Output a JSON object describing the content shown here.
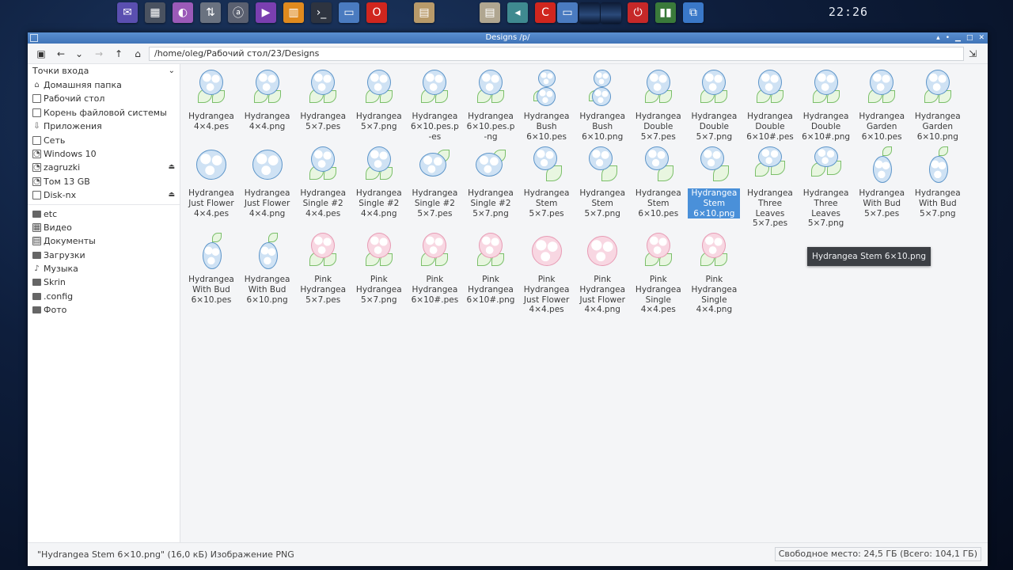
{
  "panel": {
    "clock": "22:26",
    "launchers": [
      {
        "name": "mail-launcher-icon",
        "glyph": "✉",
        "color": "#5a4fb0"
      },
      {
        "name": "calculator-launcher-icon",
        "glyph": "▦",
        "color": "#4a5260"
      },
      {
        "name": "paint-launcher-icon",
        "glyph": "◐",
        "color": "#9b5ab8"
      },
      {
        "name": "transfer-launcher-icon",
        "glyph": "⇅",
        "color": "#6a7280"
      },
      {
        "name": "app-launcher-icon",
        "glyph": "ⓐ",
        "color": "#5a6070"
      },
      {
        "name": "media-player-launcher-icon",
        "glyph": "▶",
        "color": "#7a3fb0"
      },
      {
        "name": "audio-launcher-icon",
        "glyph": "▥",
        "color": "#e08a1e"
      },
      {
        "name": "terminal-launcher-icon",
        "glyph": "›_",
        "color": "#2e3440"
      },
      {
        "name": "file-manager-launcher-icon",
        "glyph": "▭",
        "color": "#4a7bc0"
      },
      {
        "name": "opera-launcher-icon",
        "glyph": "O",
        "color": "#d0261e"
      },
      {
        "name": "notes-launcher-icon",
        "glyph": "▤",
        "color": "#b89a6a"
      },
      {
        "name": "document-viewer-icon",
        "glyph": "▤",
        "color": "#b0a690"
      },
      {
        "name": "volume-icon",
        "glyph": "◂",
        "color": "#3f8a90"
      },
      {
        "name": "opera-window-icon",
        "glyph": "C",
        "color": "#d0261e"
      },
      {
        "name": "file-manager-window-icon",
        "glyph": "▭",
        "color": "#4a7bc0"
      },
      {
        "name": "workspace-1-icon",
        "glyph": "",
        "color": "#1a2a4a"
      },
      {
        "name": "workspace-2-icon",
        "glyph": "",
        "color": "#1a2a4a"
      },
      {
        "name": "power-icon",
        "glyph": "⏻",
        "color": "#c62828"
      },
      {
        "name": "system-monitor-icon",
        "glyph": "▮▮",
        "color": "#3a7a3a"
      },
      {
        "name": "network-icon",
        "glyph": "⧉",
        "color": "#3a78c8"
      }
    ]
  },
  "window": {
    "title": "Designs   /p/",
    "path": "/home/oleg/Рабочий стол/23/Designs"
  },
  "sidebar": {
    "header": "Точки входа",
    "places": [
      {
        "name": "sidebar-item-home",
        "icon": "home-icon",
        "glyph": "⌂",
        "label": "Домашняя папка",
        "eject": false
      },
      {
        "name": "sidebar-item-desktop",
        "icon": "desktop-icon",
        "glyph": "",
        "label": "Рабочий стол",
        "eject": false
      },
      {
        "name": "sidebar-item-root",
        "icon": "filesystem-icon",
        "glyph": "",
        "label": "Корень файловой системы",
        "eject": false
      },
      {
        "name": "sidebar-item-applications",
        "icon": "applications-icon",
        "glyph": "⇩",
        "label": "Приложения",
        "eject": false
      },
      {
        "name": "sidebar-item-network",
        "icon": "network-icon",
        "glyph": "",
        "label": "Сеть",
        "eject": false
      },
      {
        "name": "sidebar-item-windows10",
        "icon": "drive-icon",
        "glyph": "◔",
        "label": "Windows 10",
        "eject": false
      },
      {
        "name": "sidebar-item-zagruzki",
        "icon": "drive-icon",
        "glyph": "◔",
        "label": "zagruzki",
        "eject": true
      },
      {
        "name": "sidebar-item-volume-13gb",
        "icon": "drive-icon",
        "glyph": "◔",
        "label": "Том 13 GB",
        "eject": false
      },
      {
        "name": "sidebar-item-disk-nx",
        "icon": "removable-drive-icon",
        "glyph": "",
        "label": "Disk-nx",
        "eject": true
      }
    ],
    "bookmarks": [
      {
        "name": "sidebar-item-etc",
        "icon": "folder-icon",
        "glyph": "",
        "label": "etc"
      },
      {
        "name": "sidebar-item-video",
        "icon": "video-icon",
        "glyph": "▦",
        "label": "Видео"
      },
      {
        "name": "sidebar-item-documents",
        "icon": "documents-icon",
        "glyph": "▤",
        "label": "Документы"
      },
      {
        "name": "sidebar-item-downloads",
        "icon": "downloads-icon",
        "glyph": "",
        "label": "Загрузки"
      },
      {
        "name": "sidebar-item-music",
        "icon": "music-icon",
        "glyph": "♪",
        "label": "Музыка"
      },
      {
        "name": "sidebar-item-skrin",
        "icon": "folder-icon",
        "glyph": "",
        "label": "Skrin"
      },
      {
        "name": "sidebar-item-config",
        "icon": "folder-icon",
        "glyph": "",
        "label": ".config"
      },
      {
        "name": "sidebar-item-photo",
        "icon": "folder-icon",
        "glyph": "",
        "label": "Фото"
      }
    ]
  },
  "files": [
    {
      "label": "Hydrangea 4×4.pes",
      "color": "blue",
      "style": "single"
    },
    {
      "label": "Hydrangea 4×4.png",
      "color": "blue",
      "style": "single"
    },
    {
      "label": "Hydrangea 5×7.pes",
      "color": "blue",
      "style": "single"
    },
    {
      "label": "Hydrangea 5×7.png",
      "color": "blue",
      "style": "single"
    },
    {
      "label": "Hydrangea 6×10.pes.p-es",
      "color": "blue",
      "style": "single"
    },
    {
      "label": "Hydrangea 6×10.pes.p-ng",
      "color": "blue",
      "style": "single"
    },
    {
      "label": "Hydrangea Bush 6×10.pes",
      "color": "blue",
      "style": "bush"
    },
    {
      "label": "Hydrangea Bush 6×10.png",
      "color": "blue",
      "style": "bush"
    },
    {
      "label": "Hydrangea Double 5×7.pes",
      "color": "blue",
      "style": "double"
    },
    {
      "label": "Hydrangea Double 5×7.png",
      "color": "blue",
      "style": "double"
    },
    {
      "label": "Hydrangea Double 6×10#.pes",
      "color": "blue",
      "style": "double"
    },
    {
      "label": "Hydrangea Double 6×10#.png",
      "color": "blue",
      "style": "double"
    },
    {
      "label": "Hydrangea Garden 6×10.pes",
      "color": "blue",
      "style": "garden"
    },
    {
      "label": "Hydrangea Garden 6×10.png",
      "color": "blue",
      "style": "garden"
    },
    {
      "label": "Hydrangea Just Flower 4×4.pes",
      "color": "blue",
      "style": "flower"
    },
    {
      "label": "Hydrangea Just Flower 4×4.png",
      "color": "blue",
      "style": "flower"
    },
    {
      "label": "Hydrangea Single #2 4×4.pes",
      "color": "blue",
      "style": "single"
    },
    {
      "label": "Hydrangea Single #2 4×4.png",
      "color": "blue",
      "style": "single"
    },
    {
      "label": "Hydrangea Single #2 5×7.pes",
      "color": "blue",
      "style": "wide"
    },
    {
      "label": "Hydrangea Single #2 5×7.png",
      "color": "blue",
      "style": "wide"
    },
    {
      "label": "Hydrangea Stem 5×7.pes",
      "color": "blue",
      "style": "stem"
    },
    {
      "label": "Hydrangea Stem 5×7.png",
      "color": "blue",
      "style": "stem"
    },
    {
      "label": "Hydrangea Stem 6×10.pes",
      "color": "blue",
      "style": "stem"
    },
    {
      "label": "Hydrangea Stem 6×10.png",
      "color": "blue",
      "style": "stem",
      "selected": true
    },
    {
      "label": "Hydrangea Three Leaves 5×7.pes",
      "color": "blue",
      "style": "leaves"
    },
    {
      "label": "Hydrangea Three Leaves 5×7.png",
      "color": "blue",
      "style": "leaves"
    },
    {
      "label": "Hydrangea With Bud 5×7.pes",
      "color": "blue",
      "style": "bud"
    },
    {
      "label": "Hydrangea With Bud 5×7.png",
      "color": "blue",
      "style": "bud"
    },
    {
      "label": "Hydrangea With Bud 6×10.pes",
      "color": "blue",
      "style": "bud"
    },
    {
      "label": "Hydrangea With Bud 6×10.png",
      "color": "blue",
      "style": "bud"
    },
    {
      "label": "Pink Hydrangea 5×7.pes",
      "color": "pink",
      "style": "single"
    },
    {
      "label": "Pink Hydrangea 5×7.png",
      "color": "pink",
      "style": "single"
    },
    {
      "label": "Pink Hydrangea 6×10#.pes",
      "color": "pink",
      "style": "single"
    },
    {
      "label": "Pink Hydrangea 6×10#.png",
      "color": "pink",
      "style": "single"
    },
    {
      "label": "Pink Hydrangea Just Flower 4×4.pes",
      "color": "pink",
      "style": "flower"
    },
    {
      "label": "Pink Hydrangea Just Flower 4×4.png",
      "color": "pink",
      "style": "flower"
    },
    {
      "label": "Pink Hydrangea Single 4×4.pes",
      "color": "pink",
      "style": "single"
    },
    {
      "label": "Pink Hydrangea Single 4×4.png",
      "color": "pink",
      "style": "single"
    }
  ],
  "tooltip": "Hydrangea Stem 6×10.png",
  "status": {
    "selection": "\"Hydrangea Stem 6×10.png\" (16,0 кБ) Изображение PNG",
    "free_space": "Свободное место: 24,5 ГБ (Всего: 104,1 ГБ)"
  }
}
